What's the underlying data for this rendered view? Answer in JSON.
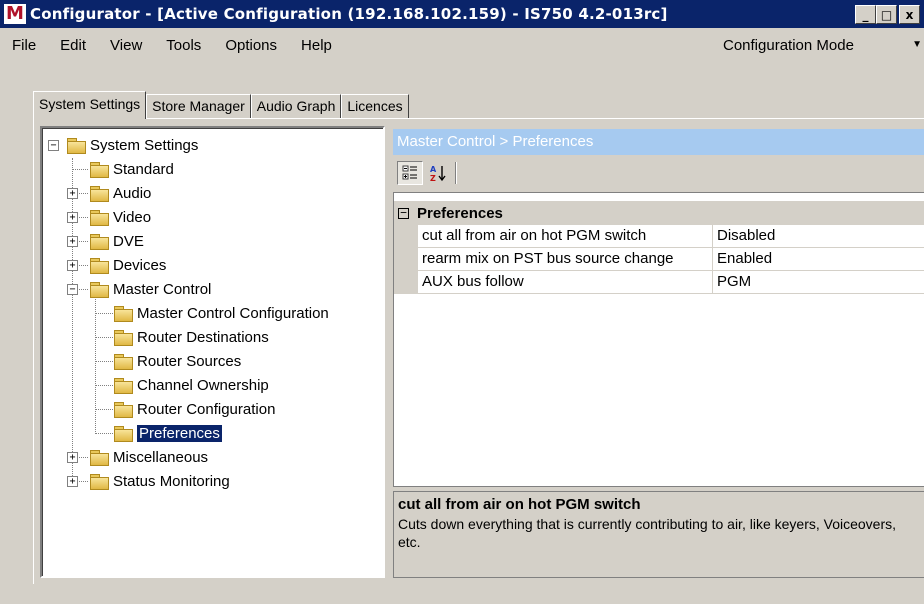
{
  "window": {
    "logo": "M",
    "title": "Configurator - [Active Configuration (192.168.102.159) - IS750 4.2-013rc]",
    "minimize": "_",
    "maximize": "□",
    "close": "x"
  },
  "menu": {
    "items": [
      "File",
      "Edit",
      "View",
      "Tools",
      "Options",
      "Help"
    ],
    "mode": "Configuration Mode"
  },
  "tabs": [
    "System Settings",
    "Store Manager",
    "Audio Graph",
    "Licences"
  ],
  "tree": {
    "root": "System Settings",
    "items": [
      {
        "label": "Standard"
      },
      {
        "label": "Audio"
      },
      {
        "label": "Video"
      },
      {
        "label": "DVE"
      },
      {
        "label": "Devices"
      },
      {
        "label": "Master Control"
      },
      {
        "label": "Master Control Configuration"
      },
      {
        "label": "Router Destinations"
      },
      {
        "label": "Router Sources"
      },
      {
        "label": "Channel Ownership"
      },
      {
        "label": "Router Configuration"
      },
      {
        "label": "Preferences"
      },
      {
        "label": "Miscellaneous"
      },
      {
        "label": "Status Monitoring"
      }
    ]
  },
  "right": {
    "breadcrumb": "Master Control > Preferences",
    "category": "Preferences",
    "properties": [
      {
        "name": "cut all from air on hot PGM switch",
        "value": "Disabled"
      },
      {
        "name": "rearm mix on PST bus source change",
        "value": "Enabled"
      },
      {
        "name": "AUX bus follow",
        "value": "PGM"
      }
    ],
    "help": {
      "title": "cut all from air on hot PGM switch",
      "description": "Cuts down everything that is currently contributing to air, like keyers, Voiceovers, etc."
    }
  },
  "colors": {
    "titlebar": "#0a246a",
    "selection": "#0a246a",
    "breadcrumb_bg": "#a6caf0",
    "window_bg": "#d4d0c8"
  }
}
